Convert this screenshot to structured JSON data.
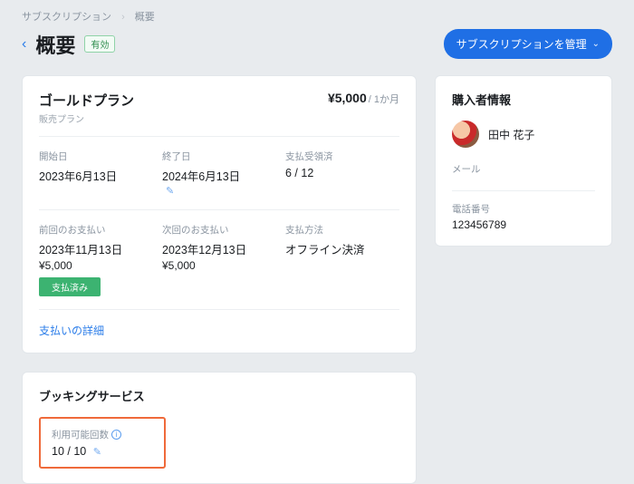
{
  "breadcrumb": {
    "root": "サブスクリプション",
    "current": "概要"
  },
  "header": {
    "title": "概要",
    "active_badge": "有効",
    "manage_btn": "サブスクリプションを管理"
  },
  "plan": {
    "name": "ゴールドプラン",
    "sub": "販売プラン",
    "price": "¥5,000",
    "period": "/ 1か月"
  },
  "dates": {
    "start_lbl": "開始日",
    "start_val": "2023年6月13日",
    "end_lbl": "終了日",
    "end_val": "2024年6月13日",
    "received_lbl": "支払受領済",
    "received_val": "6 / 12"
  },
  "payments": {
    "prev_lbl": "前回のお支払い",
    "prev_date": "2023年11月13日",
    "prev_amount": "¥5,000",
    "paid_badge": "支払済み",
    "next_lbl": "次回のお支払い",
    "next_date": "2023年12月13日",
    "next_amount": "¥5,000",
    "method_lbl": "支払方法",
    "method_val": "オフライン決済",
    "details_link": "支払いの詳細"
  },
  "booking": {
    "title": "ブッキングサービス",
    "avail_lbl": "利用可能回数",
    "avail_val": "10 / 10"
  },
  "buyer": {
    "title": "購入者情報",
    "name": "田中 花子",
    "email_lbl": "メール",
    "phone_lbl": "電話番号",
    "phone_val": "123456789"
  }
}
